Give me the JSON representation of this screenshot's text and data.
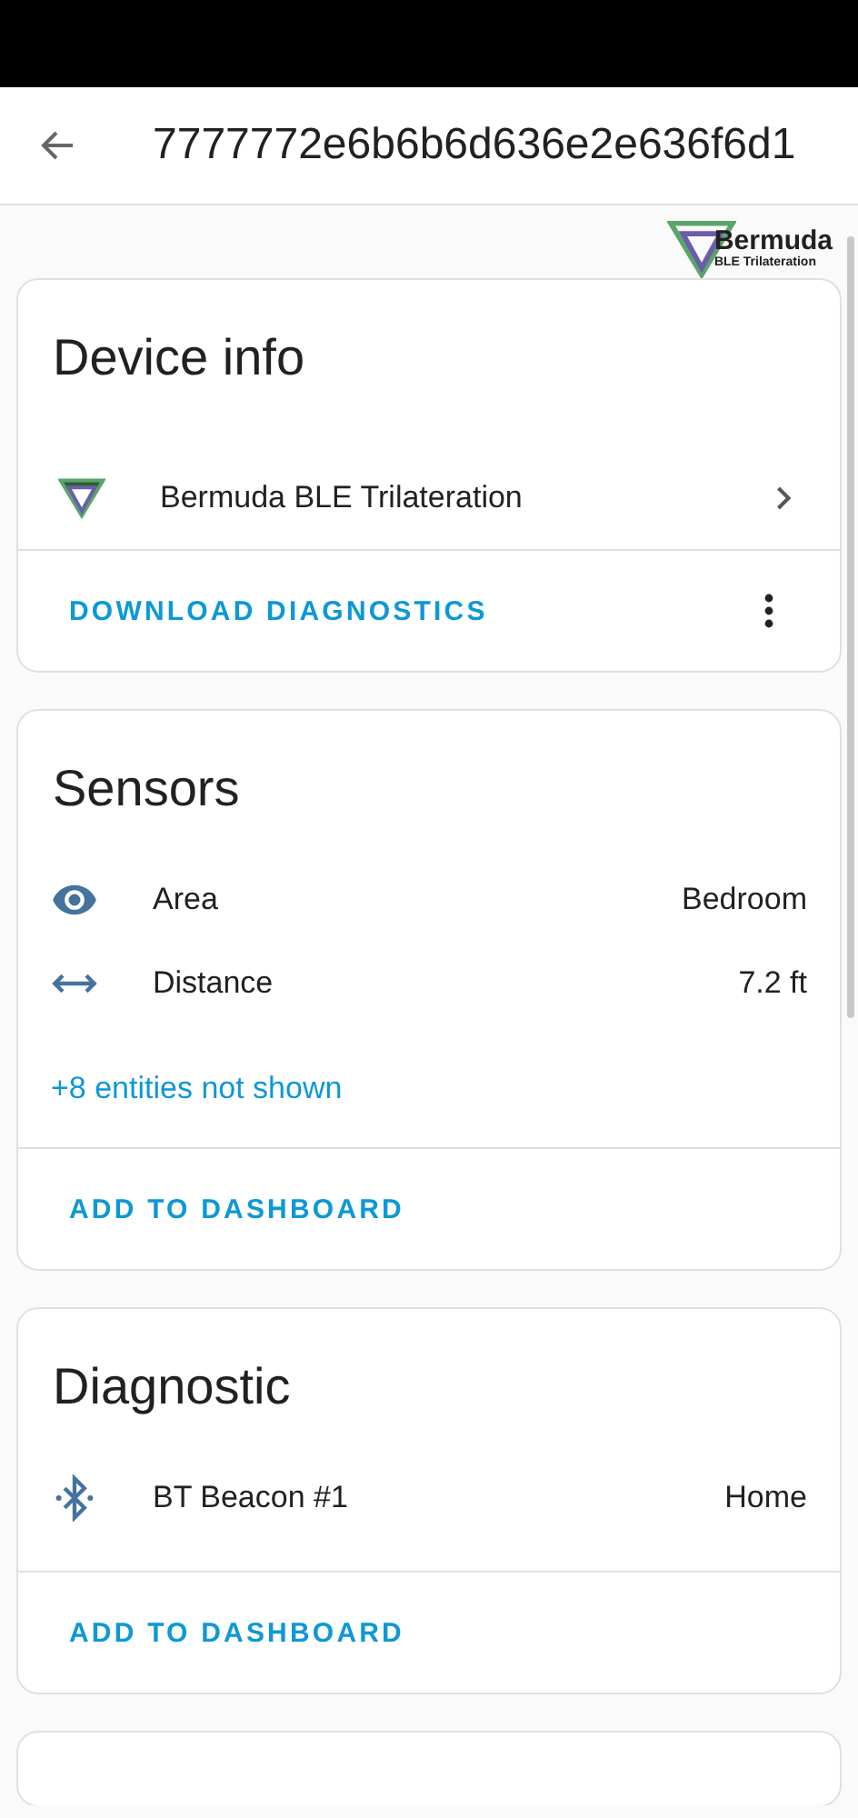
{
  "header": {
    "title": "7777772e6b6b6d636e2e636f6d1"
  },
  "logo": {
    "name": "Bermuda",
    "tagline": "BLE Trilateration"
  },
  "device_info": {
    "title": "Device info",
    "device": "Bermuda BLE Trilateration",
    "action": "DOWNLOAD DIAGNOSTICS"
  },
  "sensors": {
    "title": "Sensors",
    "rows": [
      {
        "kind": "eye",
        "name": "Area",
        "value": "Bedroom"
      },
      {
        "kind": "distance",
        "name": "Distance",
        "value": "7.2 ft"
      }
    ],
    "more": "+8 entities not shown",
    "action": "ADD TO DASHBOARD"
  },
  "diagnostic": {
    "title": "Diagnostic",
    "rows": [
      {
        "kind": "bluetooth",
        "name": "BT Beacon #1",
        "value": "Home"
      }
    ],
    "action": "ADD TO DASHBOARD"
  }
}
